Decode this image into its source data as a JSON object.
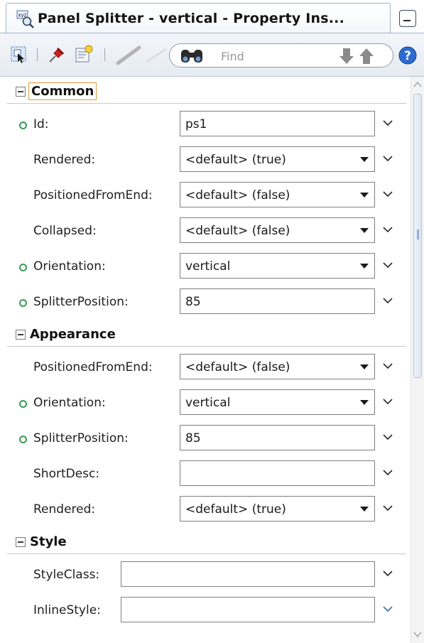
{
  "window": {
    "title": "Panel Splitter - vertical - Property Ins..."
  },
  "toolbar": {
    "search": {
      "placeholder": "Find"
    }
  },
  "sections": {
    "common": {
      "title": "Common",
      "rows": [
        {
          "label": "Id:",
          "value": "ps1",
          "kind": "text",
          "set": true
        },
        {
          "label": "Rendered:",
          "value": "<default> (true)",
          "kind": "select",
          "set": false
        },
        {
          "label": "PositionedFromEnd:",
          "value": "<default> (false)",
          "kind": "select",
          "set": false
        },
        {
          "label": "Collapsed:",
          "value": "<default> (false)",
          "kind": "select",
          "set": false
        },
        {
          "label": "Orientation:",
          "value": "vertical",
          "kind": "select",
          "set": true
        },
        {
          "label": "SplitterPosition:",
          "value": "85",
          "kind": "text",
          "set": true
        }
      ]
    },
    "appearance": {
      "title": "Appearance",
      "rows": [
        {
          "label": "PositionedFromEnd:",
          "value": "<default> (false)",
          "kind": "select",
          "set": false
        },
        {
          "label": "Orientation:",
          "value": "vertical",
          "kind": "select",
          "set": true
        },
        {
          "label": "SplitterPosition:",
          "value": "85",
          "kind": "text",
          "set": true
        },
        {
          "label": "ShortDesc:",
          "value": "",
          "kind": "text",
          "set": false
        },
        {
          "label": "Rendered:",
          "value": "<default> (true)",
          "kind": "select",
          "set": false
        }
      ]
    },
    "style": {
      "title": "Style",
      "rows": [
        {
          "label": "StyleClass:",
          "value": "",
          "kind": "text",
          "set": false
        },
        {
          "label": "InlineStyle:",
          "value": "",
          "kind": "text",
          "set": false
        }
      ]
    }
  },
  "colors": {
    "set_indicator": "#3a9a5a",
    "chevron_default": "#2a2a2a",
    "chevron_active": "#3a6fb0",
    "focus_outline": "#e09a3c"
  },
  "icons": [
    "property-inspector-icon",
    "minimize-icon",
    "select-component-icon",
    "pin-icon",
    "edit-properties-icon",
    "pencil-icon",
    "binoculars-icon",
    "arrow-down-icon",
    "arrow-up-icon",
    "help-icon",
    "expander-minus-icon",
    "chevron-down-icon"
  ]
}
